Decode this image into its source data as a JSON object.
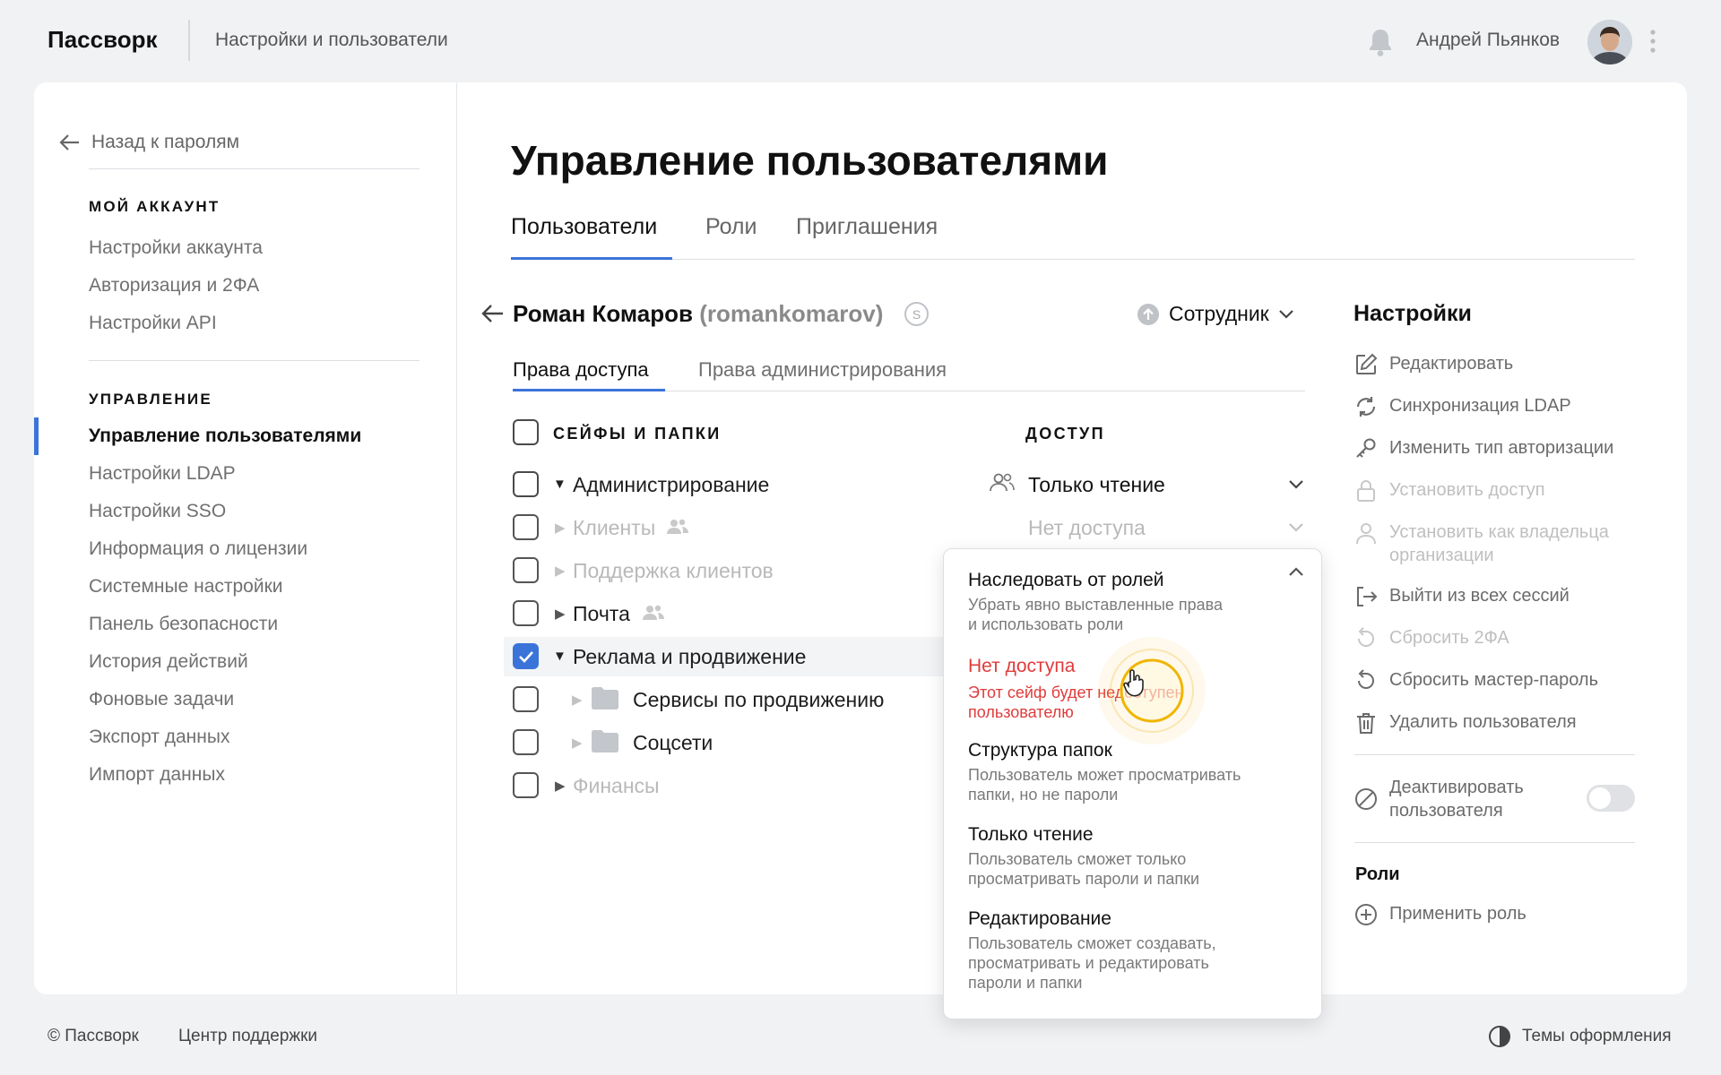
{
  "app": {
    "name": "Пассворк",
    "section": "Настройки и пользователи"
  },
  "header": {
    "user_name": "Андрей Пьянков",
    "icons": [
      "bell-icon",
      "avatar",
      "kebab-icon"
    ]
  },
  "sidebar": {
    "back_label": "Назад к паролям",
    "account_heading": "МОЙ АККАУНТ",
    "account_items": [
      "Настройки аккаунта",
      "Авторизация и 2ФА",
      "Настройки API"
    ],
    "manage_heading": "УПРАВЛЕНИЕ",
    "manage_items": [
      "Управление пользователями",
      "Настройки LDAP",
      "Настройки SSO",
      "Информация о лицензии",
      "Системные настройки",
      "Панель безопасности",
      "История действий",
      "Фоновые задачи",
      "Экспорт данных",
      "Импорт данных"
    ],
    "active_item": "Управление пользователями"
  },
  "main": {
    "title": "Управление пользователями",
    "tabs": [
      "Пользователи",
      "Роли",
      "Приглашения"
    ],
    "active_tab": "Пользователи",
    "user": {
      "name": "Роман Комаров",
      "login": "(romankomarov)",
      "badge": "S",
      "role": "Сотрудник"
    },
    "subtabs": [
      "Права доступа",
      "Права администрирования"
    ],
    "active_subtab": "Права доступа",
    "table": {
      "col_vaults": "СЕЙФЫ И ПАПКИ",
      "col_access": "ДОСТУП",
      "rows": [
        {
          "label": "Администрирование",
          "access": "Только чтение",
          "checked": false
        },
        {
          "label": "Клиенты",
          "access": "Нет доступа",
          "checked": false
        },
        {
          "label": "Поддержка клиентов",
          "access": "",
          "checked": false
        },
        {
          "label": "Почта",
          "access": "",
          "checked": false
        },
        {
          "label": "Реклама и продвижение",
          "access": "",
          "checked": true
        },
        {
          "label": "Сервисы по продвижению",
          "access": "",
          "checked": false
        },
        {
          "label": "Соцсети",
          "access": "",
          "checked": false
        },
        {
          "label": "Финансы",
          "access": "",
          "checked": false
        }
      ]
    },
    "dropdown": {
      "options": [
        {
          "title": "Наследовать от ролей",
          "desc1": "Убрать явно выставленные права",
          "desc2": "и использовать роли"
        },
        {
          "title": "Нет доступа",
          "desc1": "Этот сейф будет недоступен",
          "desc2": "пользователю"
        },
        {
          "title": "Структура папок",
          "desc1": "Пользователь может просматривать",
          "desc2": "папки, но не пароли"
        },
        {
          "title": "Только чтение",
          "desc1": "Пользователь сможет только",
          "desc2": "просматривать пароли и папки"
        },
        {
          "title": "Редактирование",
          "desc1": "Пользователь сможет создавать,",
          "desc2": "просматривать и редактировать",
          "desc3": "пароли и папки"
        }
      ]
    }
  },
  "settings": {
    "heading": "Настройки",
    "items": [
      "Редактировать",
      "Синхронизация LDAP",
      "Изменить тип авторизации",
      "Установить доступ",
      "Установить как владельца",
      "организации",
      "Выйти из всех сессий",
      "Сбросить 2ФА",
      "Сбросить мастер-пароль",
      "Удалить пользователя"
    ],
    "deactivate": [
      "Деактивировать",
      "пользователя"
    ],
    "deactivate_enabled": false,
    "roles_heading": "Роли",
    "apply_role": "Применить роль"
  },
  "footer": {
    "copyright": "© Пассворк",
    "support": "Центр поддержки",
    "themes": "Темы оформления"
  },
  "colors": {
    "accent": "#3b74d9",
    "danger": "#e03b3b",
    "highlight": "#f3b400"
  }
}
